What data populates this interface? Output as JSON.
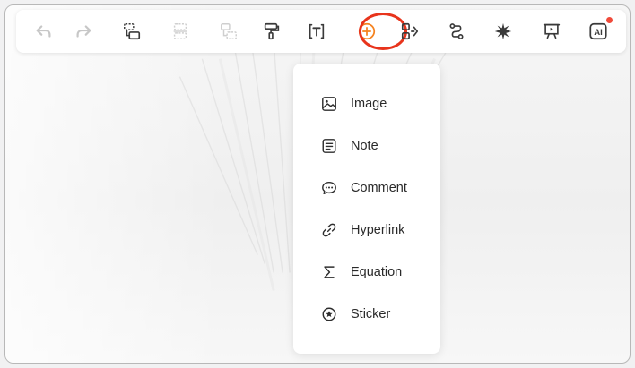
{
  "colors": {
    "accent": "#f5821f",
    "highlight_ring": "#e8341c",
    "icon": "#3a3a3a",
    "icon_disabled": "#b5b5b5",
    "notification_dot": "#f04a3a"
  },
  "toolbar": {
    "tools": [
      {
        "icon": "undo-icon",
        "state": "disabled"
      },
      {
        "icon": "redo-icon",
        "state": "disabled"
      },
      {
        "icon": "group-icon",
        "state": "enabled"
      },
      {
        "icon": "ungroup-icon",
        "state": "disabled"
      },
      {
        "icon": "unframe-icon",
        "state": "disabled"
      },
      {
        "icon": "format-painter-icon",
        "state": "enabled"
      },
      {
        "icon": "text-icon",
        "state": "enabled"
      },
      {
        "icon": "insert-plus-icon",
        "state": "active"
      },
      {
        "icon": "mind-map-icon",
        "state": "enabled"
      },
      {
        "icon": "connector-icon",
        "state": "enabled"
      },
      {
        "icon": "laser-pointer-icon",
        "state": "enabled"
      },
      {
        "icon": "presentation-icon",
        "state": "enabled"
      },
      {
        "icon": "ai-assistant-icon",
        "state": "enabled",
        "ai_label": "AI",
        "notification": true
      }
    ]
  },
  "insert_menu": {
    "items": [
      {
        "label": "Image",
        "icon": "image-icon"
      },
      {
        "label": "Note",
        "icon": "note-icon"
      },
      {
        "label": "Comment",
        "icon": "comment-icon"
      },
      {
        "label": "Hyperlink",
        "icon": "link-icon"
      },
      {
        "label": "Equation",
        "icon": "sigma-icon"
      },
      {
        "label": "Sticker",
        "icon": "sticker-icon"
      }
    ]
  }
}
